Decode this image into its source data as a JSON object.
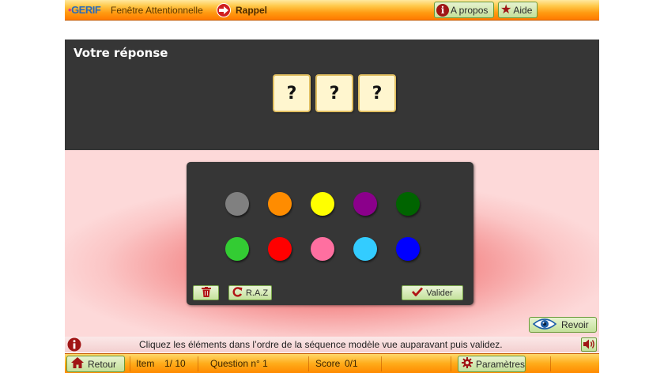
{
  "topbar": {
    "logo_prefix": "•",
    "logo_text": "GERIF",
    "app_title": "Fenêtre Attentionnelle",
    "rappel_label": "Rappel",
    "about_label": "A propos",
    "help_label": "Aide"
  },
  "answer": {
    "title": "Votre réponse",
    "slots": [
      "?",
      "?",
      "?"
    ]
  },
  "colors": {
    "row1": [
      "#808080",
      "#ff8c00",
      "#ffff00",
      "#8b008b",
      "#006400"
    ],
    "row2": [
      "#33cc33",
      "#ff0000",
      "#ff6fa0",
      "#33ccff",
      "#0000ff"
    ]
  },
  "board": {
    "raz_label": "R.A.Z",
    "validate_label": "Valider"
  },
  "revoir_label": "Revoir",
  "instruction": "Cliquez les éléments dans l’ordre de la séquence modèle vue auparavant puis validez.",
  "bottombar": {
    "back_label": "Retour",
    "item_label": "Item",
    "item_value": "1/ 10",
    "question_label": "Question n° 1",
    "score_label": "Score",
    "score_value": "0/1",
    "settings_label": "Paramètres"
  },
  "accent_colors": {
    "topbar": "#ff9a10",
    "panel": "#363636",
    "button_green": "#c3e09a",
    "icon_red": "#a01515"
  }
}
